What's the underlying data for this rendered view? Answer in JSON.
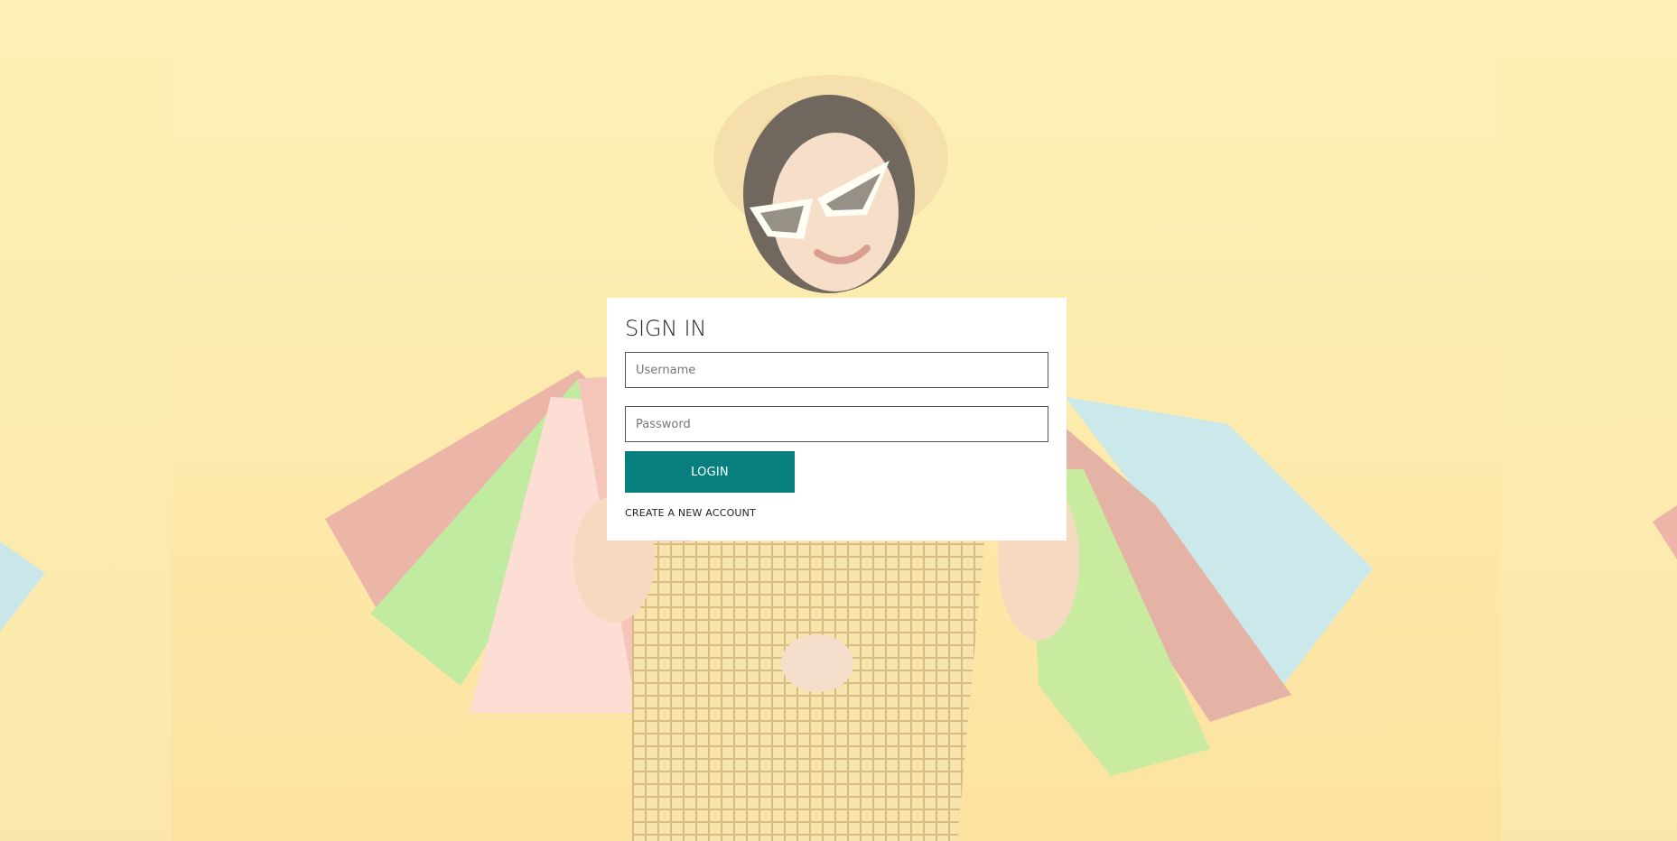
{
  "theme": {
    "accent": "#077f7f",
    "background": "#fde9a6"
  },
  "hero_image": {
    "description_icon": "shopping-woman-with-bags-image"
  },
  "signin": {
    "title": "SIGN IN",
    "username_placeholder": "Username",
    "password_placeholder": "Password",
    "login_label": "LOGIN",
    "create_account_label": "CREATE A NEW ACCOUNT"
  }
}
